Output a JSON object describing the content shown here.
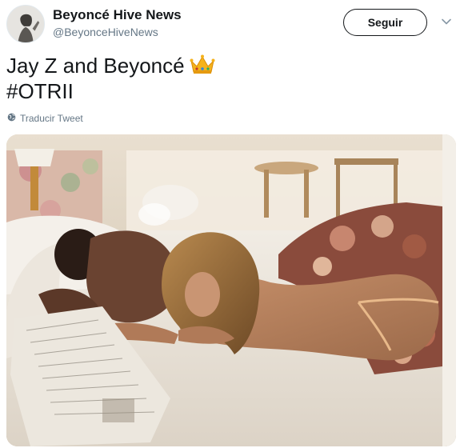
{
  "user": {
    "display_name": "Beyoncé Hive News",
    "handle": "@BeyonceHiveNews",
    "avatar_icon": "profile-avatar"
  },
  "actions": {
    "follow_label": "Seguir",
    "menu_icon": "chevron-down-icon"
  },
  "tweet": {
    "line1": "Jay Z and Beyoncé",
    "emoji": "crown-emoji",
    "line2": "#OTRII",
    "translate_label": "Traducir Tweet",
    "translate_icon": "globe-icon"
  },
  "media": {
    "description_icon": "photo"
  },
  "colors": {
    "text": "#14171a",
    "secondary": "#657786",
    "border": "#e1e8ed"
  }
}
